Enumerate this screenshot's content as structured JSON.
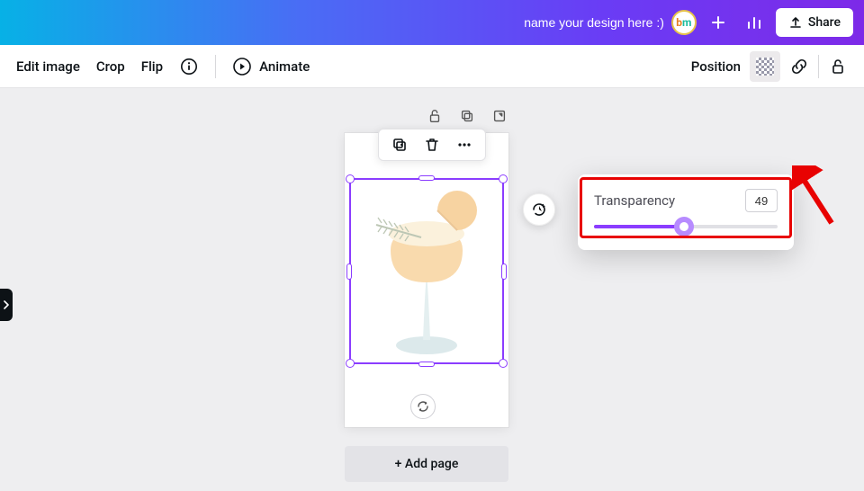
{
  "header": {
    "title_placeholder": "name your design here :)",
    "badge_text_b": "b",
    "badge_text_m": "m",
    "share_label": "Share"
  },
  "toolbar": {
    "edit_image_label": "Edit image",
    "crop_label": "Crop",
    "flip_label": "Flip",
    "animate_label": "Animate",
    "position_label": "Position"
  },
  "transparency": {
    "label": "Transparency",
    "value": "49",
    "percent": 49
  },
  "canvas": {
    "add_page_label": "+ Add page"
  },
  "colors": {
    "accent": "#8b3dff",
    "annotation": "#e80202"
  }
}
